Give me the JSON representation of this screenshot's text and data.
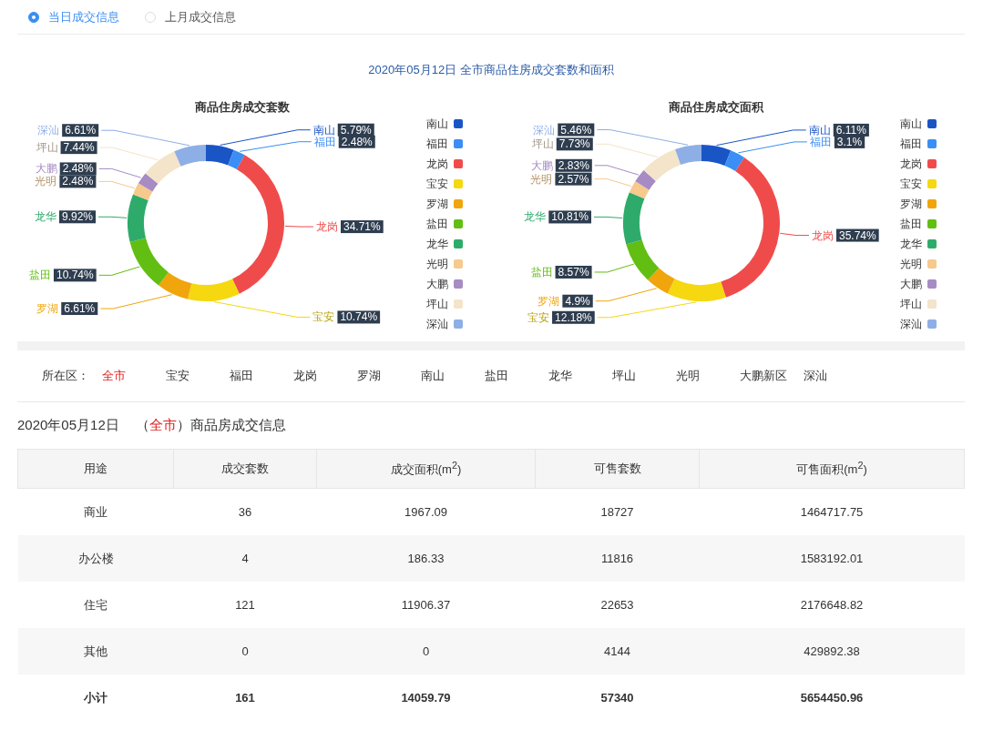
{
  "view_options": [
    {
      "label": "当日成交信息",
      "selected": true
    },
    {
      "label": "上月成交信息",
      "selected": false
    }
  ],
  "charts_title": "2020年05月12日 全市商品住房成交套数和面积",
  "charts": [
    {
      "legend": [
        {
          "label": "南山",
          "color": "#1a55c6"
        },
        {
          "label": "福田",
          "color": "#3a8ef5"
        },
        {
          "label": "龙岗",
          "color": "#f04b4b"
        },
        {
          "label": "宝安",
          "color": "#f5d80f"
        },
        {
          "label": "罗湖",
          "color": "#f0a50c"
        },
        {
          "label": "盐田",
          "color": "#62be12"
        },
        {
          "label": "龙华",
          "color": "#2eab6b"
        },
        {
          "label": "光明",
          "color": "#f6c98c"
        },
        {
          "label": "大鹏",
          "color": "#a78bc3"
        },
        {
          "label": "坪山",
          "color": "#f3e4ca"
        },
        {
          "label": "深汕",
          "color": "#8eaee6"
        }
      ],
      "chart_data": {
        "type": "donut",
        "title": "商品住房成交套数",
        "categories": [
          "南山",
          "福田",
          "龙岗",
          "宝安",
          "罗湖",
          "盐田",
          "龙华",
          "光明",
          "大鹏",
          "坪山",
          "深汕"
        ],
        "values": [
          5.79,
          2.48,
          34.71,
          10.74,
          6.61,
          10.74,
          9.92,
          2.48,
          2.48,
          7.44,
          6.61
        ],
        "value_labels": [
          "5.79%",
          "2.48%",
          "34.71%",
          "10.74%",
          "6.61%",
          "10.74%",
          "9.92%",
          "2.48%",
          "2.48%",
          "7.44%",
          "6.61%"
        ]
      }
    },
    {
      "legend": [
        {
          "label": "南山",
          "color": "#1a55c6"
        },
        {
          "label": "福田",
          "color": "#3a8ef5"
        },
        {
          "label": "龙岗",
          "color": "#f04b4b"
        },
        {
          "label": "宝安",
          "color": "#f5d80f"
        },
        {
          "label": "罗湖",
          "color": "#f0a50c"
        },
        {
          "label": "盐田",
          "color": "#62be12"
        },
        {
          "label": "龙华",
          "color": "#2eab6b"
        },
        {
          "label": "光明",
          "color": "#f6c98c"
        },
        {
          "label": "大鹏",
          "color": "#a78bc3"
        },
        {
          "label": "坪山",
          "color": "#f3e4ca"
        },
        {
          "label": "深汕",
          "color": "#8eaee6"
        }
      ],
      "chart_data": {
        "type": "donut",
        "title": "商品住房成交面积",
        "categories": [
          "南山",
          "福田",
          "龙岗",
          "宝安",
          "罗湖",
          "盐田",
          "龙华",
          "光明",
          "大鹏",
          "坪山",
          "深汕"
        ],
        "values": [
          6.11,
          3.1,
          35.74,
          12.18,
          4.9,
          8.57,
          10.81,
          2.57,
          2.83,
          7.73,
          5.46
        ],
        "value_labels": [
          "6.11%",
          "3.1%",
          "35.74%",
          "12.18%",
          "4.9%",
          "8.57%",
          "10.81%",
          "2.57%",
          "2.83%",
          "7.73%",
          "5.46%"
        ]
      }
    }
  ],
  "district_filter": {
    "label": "所在区：",
    "items": [
      {
        "label": "全市",
        "selected": true
      },
      {
        "label": "宝安",
        "selected": false
      },
      {
        "label": "福田",
        "selected": false
      },
      {
        "label": "龙岗",
        "selected": false
      },
      {
        "label": "罗湖",
        "selected": false
      },
      {
        "label": "南山",
        "selected": false
      },
      {
        "label": "盐田",
        "selected": false
      },
      {
        "label": "龙华",
        "selected": false
      },
      {
        "label": "坪山",
        "selected": false
      },
      {
        "label": "光明",
        "selected": false
      },
      {
        "label": "大鹏新区",
        "selected": false
      },
      {
        "label": "深汕",
        "selected": false
      }
    ]
  },
  "section_heading": {
    "date": "2020年05月12日",
    "prefix": "（",
    "region": "全市",
    "suffix": "）商品房成交信息"
  },
  "table": {
    "columns": [
      "用途",
      "成交套数",
      "成交面积(m$^{2}$)",
      "可售套数",
      "可售面积(m$^{2}$)"
    ],
    "rows": [
      {
        "kind": "item",
        "cells": [
          "商业",
          "36",
          "1967.09",
          "18727",
          "1464717.75"
        ]
      },
      {
        "kind": "item",
        "cells": [
          "办公楼",
          "4",
          "186.33",
          "11816",
          "1583192.01"
        ]
      },
      {
        "kind": "item",
        "cells": [
          "住宅",
          "121",
          "11906.37",
          "22653",
          "2176648.82"
        ]
      },
      {
        "kind": "item",
        "cells": [
          "其他",
          "0",
          "0",
          "4144",
          "429892.38"
        ]
      },
      {
        "kind": "total",
        "cells": [
          "小计",
          "161",
          "14059.79",
          "57340",
          "5654450.96"
        ]
      }
    ]
  }
}
